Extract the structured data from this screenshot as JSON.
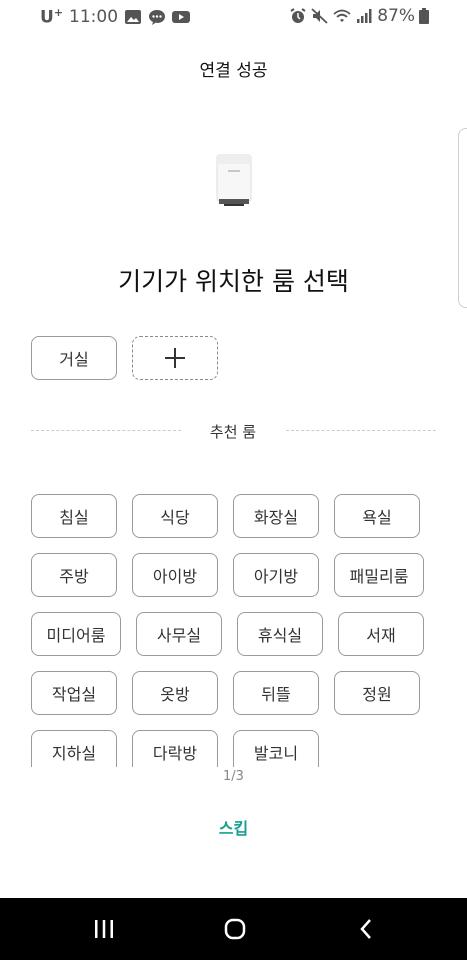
{
  "status_bar": {
    "carrier": "U",
    "carrier_sup": "+",
    "time": "11:00",
    "battery": "87%",
    "icons_left": [
      "image-icon",
      "chat-icon",
      "youtube-icon"
    ],
    "icons_right": [
      "alarm-icon",
      "mute-icon",
      "wifi-icon",
      "signal-icon",
      "battery-icon"
    ]
  },
  "header": {
    "title": "연결 성공"
  },
  "device": {
    "icon": "humidifier-device-image"
  },
  "headline": "기기가 위치한 룸 선택",
  "selected_rooms": [
    {
      "label": "거실"
    }
  ],
  "add_room": {
    "icon": "plus-icon"
  },
  "recommended": {
    "label": "추천 룸",
    "rooms": [
      "침실",
      "식당",
      "화장실",
      "욕실",
      "주방",
      "아이방",
      "아기방",
      "패밀리룸",
      "미디어룸",
      "사무실",
      "휴식실",
      "서재",
      "작업실",
      "옷방",
      "뒤뜰",
      "정원",
      "지하실",
      "다락방",
      "발코니"
    ]
  },
  "pager": "1/3",
  "skip_label": "스킵",
  "nav": {
    "icons": [
      "recent-apps-icon",
      "home-icon",
      "back-icon"
    ]
  },
  "colors": {
    "accent": "#1aa093",
    "chip_border": "#9a9a9a",
    "nav_bg": "#000000"
  }
}
